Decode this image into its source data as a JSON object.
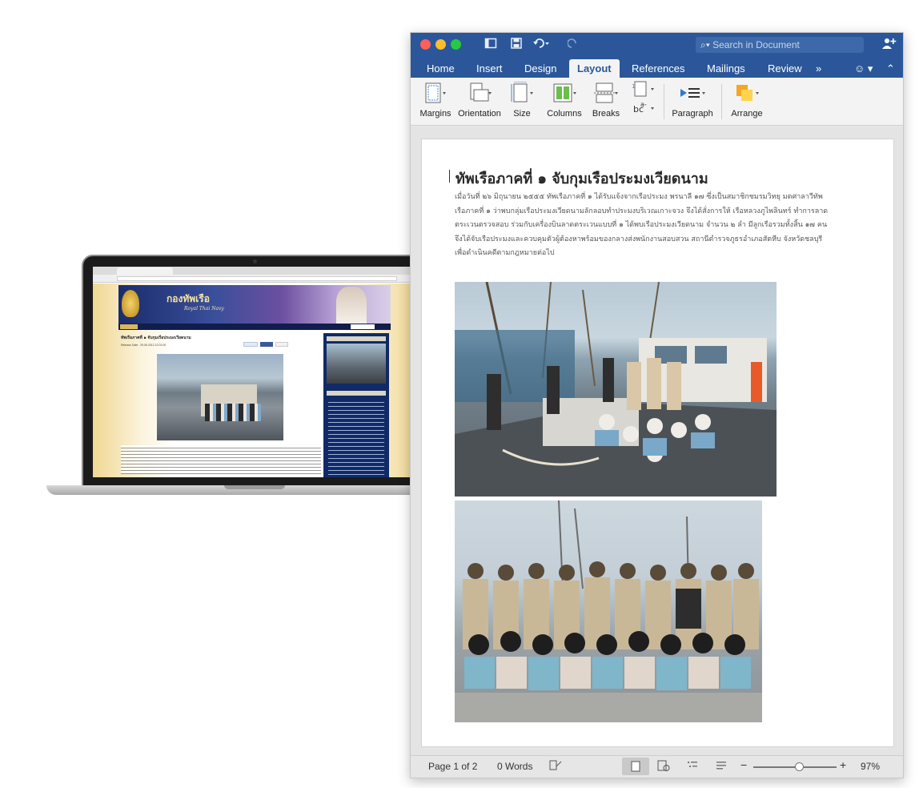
{
  "word": {
    "search_placeholder": "Search in Document",
    "tabs": [
      {
        "label": "Home"
      },
      {
        "label": "Insert"
      },
      {
        "label": "Design"
      },
      {
        "label": "Layout"
      },
      {
        "label": "References"
      },
      {
        "label": "Mailings"
      },
      {
        "label": "Review"
      },
      {
        "label": "»"
      }
    ],
    "active_tab": "Layout",
    "ribbon": {
      "margins": "Margins",
      "orientation": "Orientation",
      "size": "Size",
      "columns": "Columns",
      "breaks": "Breaks",
      "paragraph": "Paragraph",
      "arrange": "Arrange"
    },
    "document": {
      "title": "ทัพเรือภาคที่ ๑ จับกุมเรือประมงเวียดนาม",
      "body": "เมื่อวันที่ ๒๖ มิถุนายน ๒๕๕๕ ทัพเรือภาคที่ ๑ ได้รับแจ้งจากเรือประมง พรนาลี ๑๗ ซึ่งเป็นสมาชิกชมรมวิทยุ มตศาลาวีทัพเรือภาคที่ ๑ ว่าพบกลุ่มเรือประมงเวียดนามลักลอบทำประมงบริเวณเกาะจวง จึงได้สั่งการให้ เรือหลวงภูไพลินทร์ ทำการลาดตระเวนตรวจสอบ ร่วมกับเครื่องบินลาดตระเวนแบบที่ ๑ ได้พบเรือประมงเวียดนาม จำนวน ๒ ลำ มีลูกเรือรวมทั้งสิ้น ๑๗ คน จึงได้จับเรือประมงและควบคุมตัวผู้ต้องหาพร้อมของกลางส่งพนักงานสอบสวน สถานีตำรวจภูธรอำเภอสัตหีบ จังหวัดชลบุรี เพื่อดำเนินคดีตามกฎหมายต่อไป"
    },
    "status": {
      "page": "Page 1 of 2",
      "words": "0 Words",
      "zoom": "97%",
      "zoom_level": 0.55
    },
    "colors": {
      "titlebar": "#2b579a",
      "ribbon": "#f3f3f3",
      "close": "#ff5f57",
      "minimize": "#febc2e",
      "maximize": "#28c840"
    }
  },
  "laptop": {
    "site_title": "กองทัพเรือ",
    "site_subtitle": "Royal Thai Navy",
    "article_title": "ทัพเรือภาคที่ ๑ จับกุมเรือประมงเวียดนาม",
    "release_date": "Release Date : 29.06.2012 12:01:00"
  }
}
